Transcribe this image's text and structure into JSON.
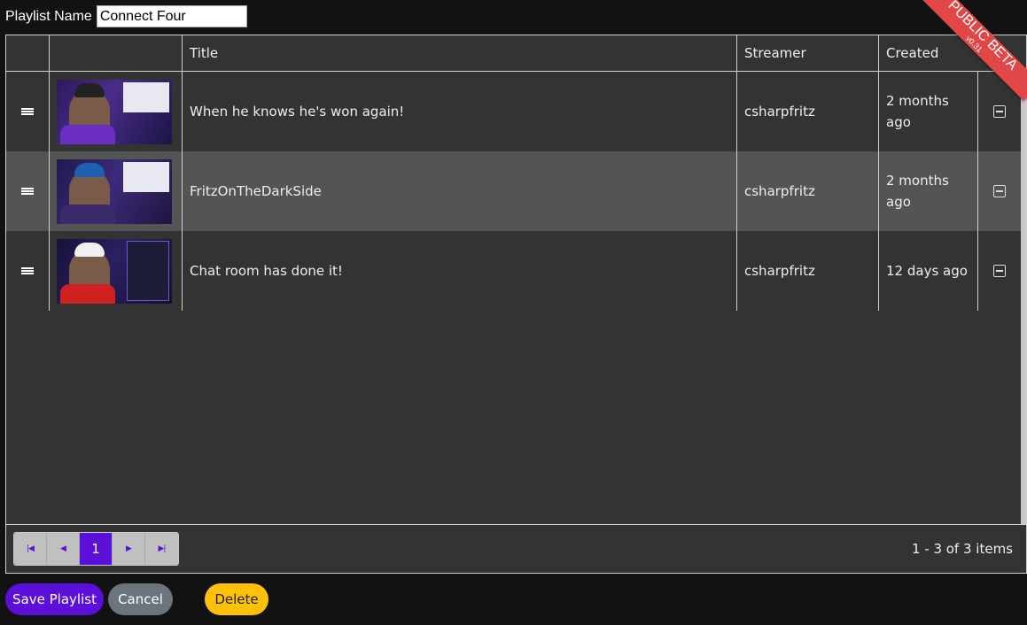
{
  "playlist": {
    "label": "Playlist Name",
    "name_value": "Connect Four"
  },
  "grid": {
    "columns": {
      "drag": "",
      "thumbnail": "",
      "title": "Title",
      "streamer": "Streamer",
      "created": "Created"
    },
    "rows": [
      {
        "title": "When he knows he's won again!",
        "streamer": "csharpfritz",
        "created": "2 months ago"
      },
      {
        "title": "FritzOnTheDarkSide",
        "streamer": "csharpfritz",
        "created": "2 months ago"
      },
      {
        "title": "Chat room has done it!",
        "streamer": "csharpfritz",
        "created": "12 days ago"
      }
    ],
    "pager": {
      "current_page": "1",
      "info": "1 - 3 of 3 items"
    }
  },
  "ribbon": {
    "text": "PUBLIC BETA",
    "version": "v0.31"
  },
  "buttons": {
    "save": "Save Playlist",
    "cancel": "Cancel",
    "delete": "Delete"
  },
  "colors": {
    "accent": "#5b0fd8",
    "warning": "#ffc107",
    "secondary": "#6c757d",
    "ribbon": "#e04848"
  }
}
